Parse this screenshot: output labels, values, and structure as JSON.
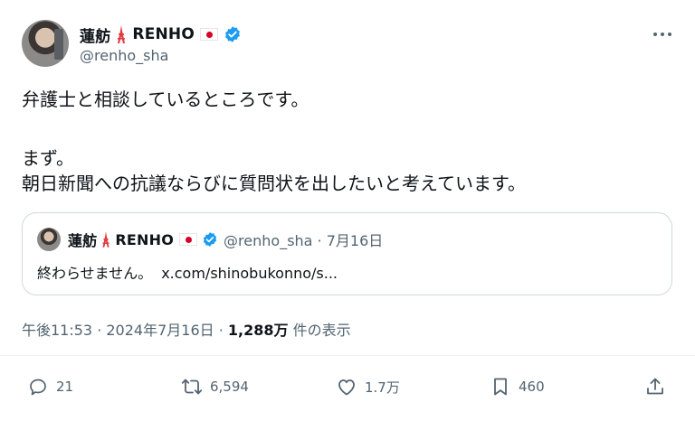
{
  "author": {
    "display_name_prefix": "蓮舫",
    "display_name_suffix": "RENHO",
    "handle": "@renho_sha"
  },
  "tweet": {
    "line1": "弁護士と相談しているところです。",
    "line2": "まず。",
    "line3": "朝日新聞への抗議ならびに質問状を出したいと考えています。"
  },
  "quote": {
    "display_name_prefix": "蓮舫",
    "display_name_suffix": "RENHO",
    "meta": "@renho_sha · 7月16日",
    "text": "終わらせません。",
    "link": "x.com/shinobukonno/s..."
  },
  "stats": {
    "time": "午後11:53 · 2024年7月16日 · ",
    "views": "1,288万",
    "views_label": " 件の表示"
  },
  "actions": {
    "reply_count": "21",
    "retweet_count": "6,594",
    "like_count": "1.7万",
    "bookmark_count": "460"
  },
  "icons": {
    "verified": "verified-badge-icon",
    "tower": "tokyo-tower-emoji-icon",
    "flag": "japan-flag-emoji-icon"
  },
  "colors": {
    "verified_blue": "#1d9bf0",
    "tower_red": "#e0393e",
    "secondary_text": "#536471"
  }
}
